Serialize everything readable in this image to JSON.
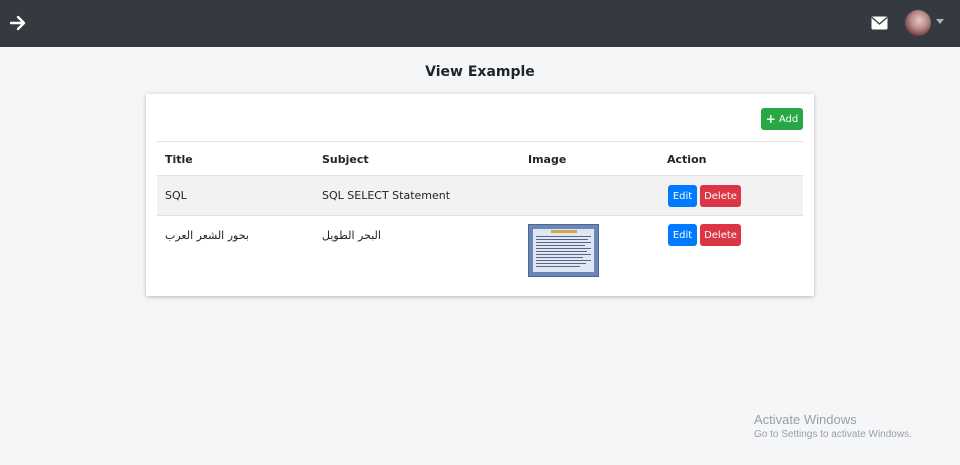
{
  "page": {
    "title": "View Example"
  },
  "toolbar": {
    "add_label": "Add"
  },
  "table": {
    "headers": [
      "Title",
      "Subject",
      "Image",
      "Action"
    ],
    "rows": [
      {
        "title": "SQL",
        "subject": "SQL SELECT Statement",
        "has_image": false,
        "edit_label": "Edit",
        "delete_label": "Delete"
      },
      {
        "title": "بحور الشعر العرب",
        "subject": "البحر الطويل",
        "has_image": true,
        "edit_label": "Edit",
        "delete_label": "Delete"
      }
    ]
  },
  "watermark": {
    "line1": "Activate Windows",
    "line2": "Go to Settings to activate Windows."
  },
  "icons": {
    "sidebar_toggle": "arrow-right-icon",
    "messages": "envelope-icon",
    "user_menu": "caret-down-icon"
  },
  "colors": {
    "navbar": "#343a40",
    "add": "#28a745",
    "edit": "#007bff",
    "delete": "#dc3545",
    "striped_row": "#f2f2f2"
  }
}
